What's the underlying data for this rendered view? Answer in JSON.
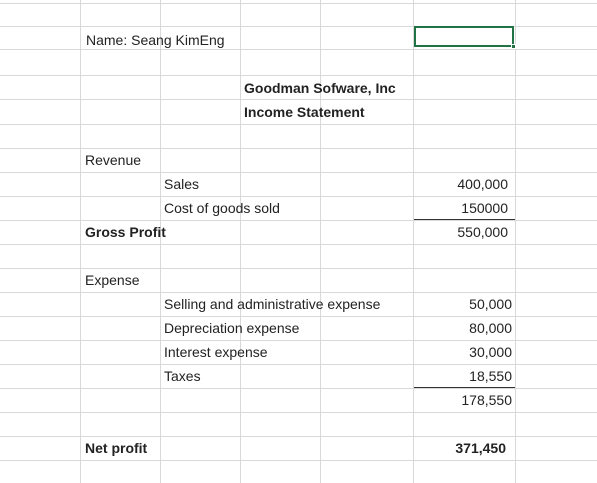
{
  "header": {
    "name": "Name: Seang KimEng"
  },
  "report": {
    "company": "Goodman Sofware, Inc",
    "title": "Income Statement"
  },
  "revenue": {
    "heading": "Revenue",
    "items": [
      {
        "label": "Sales",
        "value": "400,000"
      },
      {
        "label": "Cost of goods sold",
        "value": "150000"
      }
    ]
  },
  "gross_profit": {
    "label": "Gross Profit",
    "value": "550,000"
  },
  "expense": {
    "heading": "Expense",
    "items": [
      {
        "label": "Selling and administrative expense",
        "value": "50,000"
      },
      {
        "label": "Depreciation expense",
        "value": "80,000"
      },
      {
        "label": "Interest expense",
        "value": "30,000"
      },
      {
        "label": "Taxes",
        "value": "18,550"
      }
    ],
    "total": "178,550"
  },
  "net_profit": {
    "label": "Net profit",
    "value": "371,450"
  },
  "colors": {
    "gridline": "#d9d9d9",
    "selection": "#217346"
  }
}
